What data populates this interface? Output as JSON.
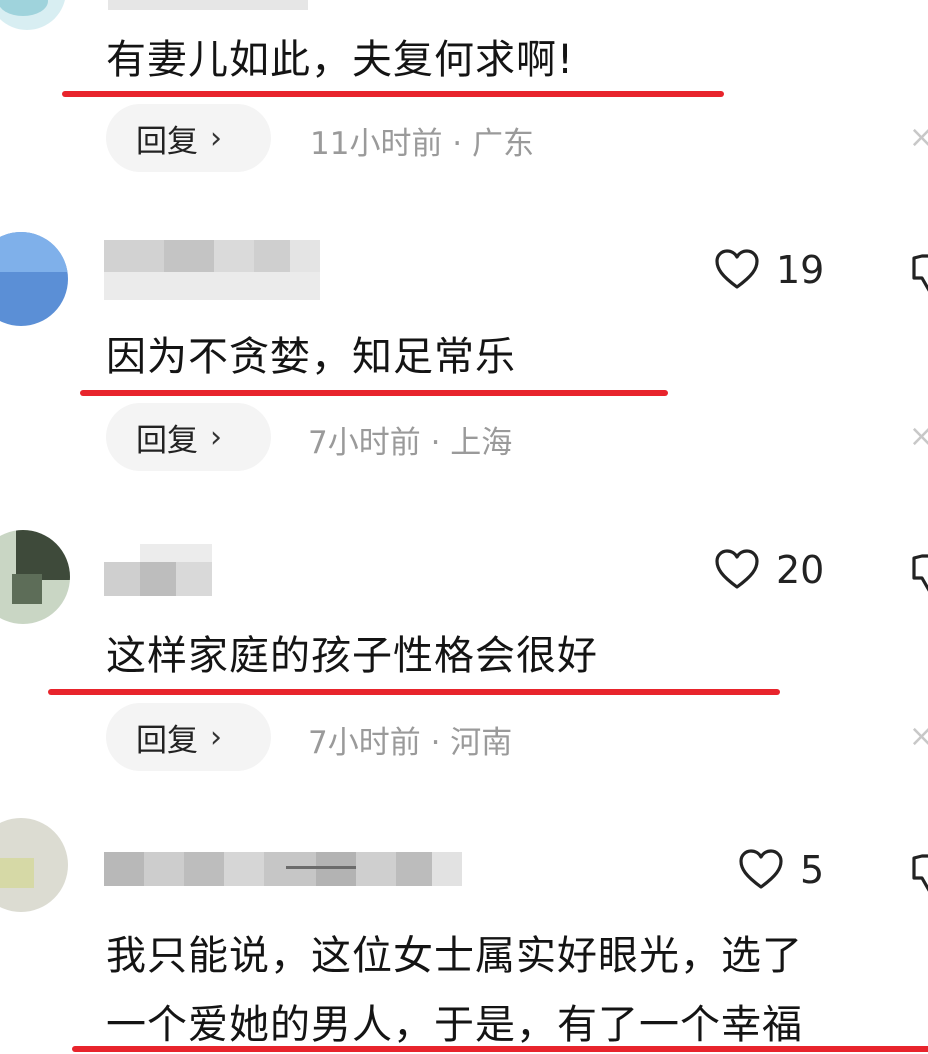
{
  "comments": [
    {
      "text": "有妻儿如此，夫复何求啊!",
      "reply_label": "回复",
      "meta": "11小时前 · 广东"
    },
    {
      "likes": "19",
      "text": "因为不贪婪，知足常乐",
      "reply_label": "回复",
      "meta": "7小时前 · 上海"
    },
    {
      "likes": "20",
      "text": "这样家庭的孩子性格会很好",
      "reply_label": "回复",
      "meta": "7小时前 · 河南"
    },
    {
      "likes": "5",
      "text_line1": "我只能说，这位女士属实好眼光，选了",
      "text_line2": "一个爱她的男人，于是，有了一个幸福"
    }
  ],
  "icons": {
    "heart": "heart-icon",
    "dislike": "thumbs-down-icon",
    "chevron": "chevron-right-icon",
    "close": "close-icon"
  },
  "colors": {
    "underline": "#e8242c",
    "meta_text": "#9a9a9a",
    "reply_bg": "#f4f4f4"
  }
}
